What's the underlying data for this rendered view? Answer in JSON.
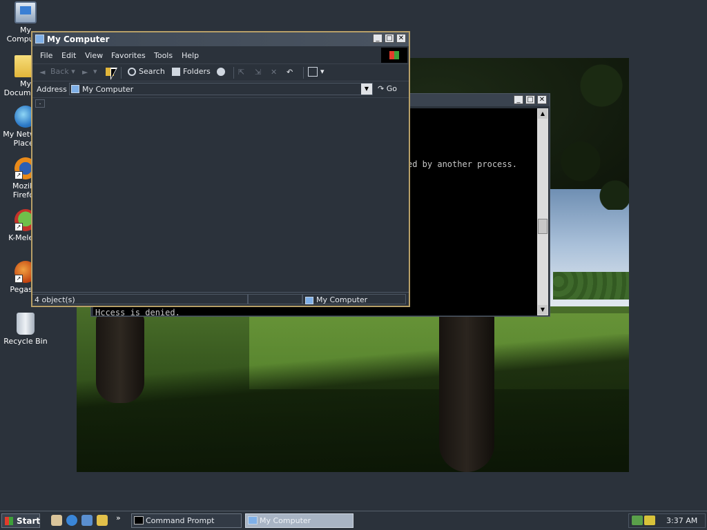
{
  "desktop": {
    "icons": [
      {
        "label": "My Computer",
        "icon": "computer-icon"
      },
      {
        "label": "My Documents",
        "icon": "folder-icon"
      },
      {
        "label": "My Network Places",
        "icon": "network-icon"
      },
      {
        "label": "Mozilla Firefox",
        "icon": "firefox-icon"
      },
      {
        "label": "K-Meleon",
        "icon": "k-meleon-icon"
      },
      {
        "label": "Pegasus",
        "icon": "pegasus-icon"
      },
      {
        "label": "Recycle Bin",
        "icon": "recycle-bin-icon"
      }
    ]
  },
  "cmd": {
    "lines": [
      "ed by another process.",
      "Hccess is denied."
    ]
  },
  "explorer": {
    "title": "My Computer",
    "menu": [
      "File",
      "Edit",
      "View",
      "Favorites",
      "Tools",
      "Help"
    ],
    "toolbar": {
      "back": "Back",
      "search": "Search",
      "folders": "Folders"
    },
    "address": {
      "label": "Address",
      "value": "My Computer",
      "go": "Go"
    },
    "content_item": ".",
    "status": {
      "objects": "4 object(s)",
      "location": "My Computer"
    }
  },
  "taskbar": {
    "start": "Start",
    "more": "»",
    "tasks": [
      {
        "label": "Command Prompt",
        "active": false
      },
      {
        "label": "My Computer",
        "active": true
      }
    ],
    "clock": "3:37 AM"
  },
  "colors": {
    "desktop": "#2b323b",
    "active_border": "#b8a068"
  }
}
